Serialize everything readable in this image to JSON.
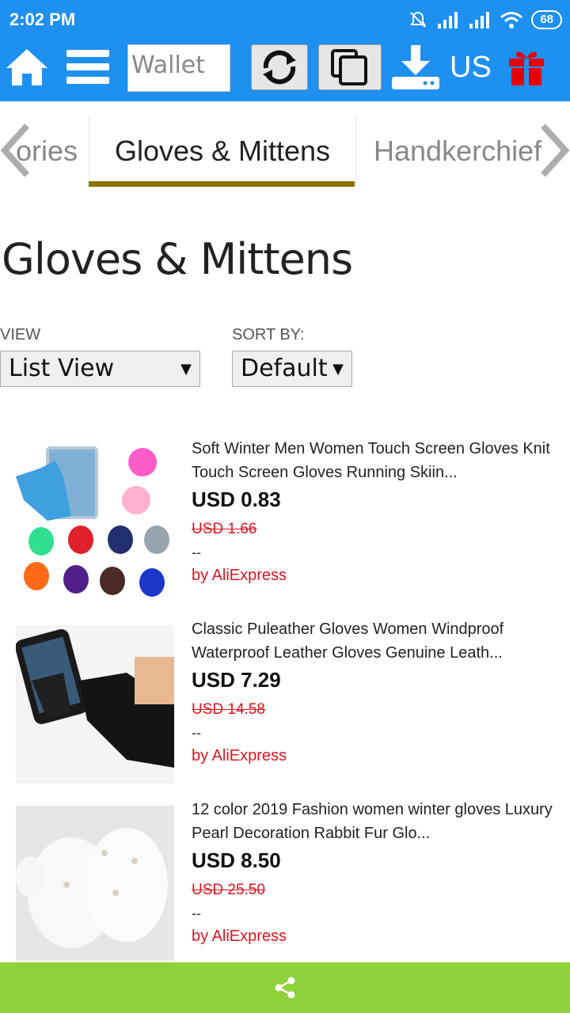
{
  "status": {
    "time": "2:02 PM",
    "battery": "68"
  },
  "toolbar": {
    "wallet_value": "Wallet",
    "region": "US"
  },
  "tabs": [
    {
      "label": "ories"
    },
    {
      "label": "Gloves & Mittens"
    },
    {
      "label": "Handkerchief"
    }
  ],
  "page": {
    "title": "Gloves & Mittens"
  },
  "controls": {
    "view_label": "VIEW",
    "view_value": "List View",
    "sort_label": "SORT BY:",
    "sort_value": "Default"
  },
  "products": [
    {
      "title": "Soft Winter Men Women Touch Screen Gloves Knit Touch Screen Gloves Running Skiin...",
      "price": "USD 0.83",
      "old_price": "USD 1.66",
      "note": "--",
      "seller": "by AliExpress"
    },
    {
      "title": "Classic Puleather Gloves Women Windproof Waterproof Leather Gloves Genuine Leath...",
      "price": "USD 7.29",
      "old_price": "USD 14.58",
      "note": "--",
      "seller": "by AliExpress"
    },
    {
      "title": "12 color 2019 Fashion women winter gloves Luxury Pearl Decoration Rabbit Fur Glo...",
      "price": "USD 8.50",
      "old_price": "USD 25.50",
      "note": "--",
      "seller": "by AliExpress"
    }
  ],
  "icons": [
    "home-icon",
    "menu-icon",
    "refresh-icon",
    "copy-icon",
    "download-icon",
    "gift-icon",
    "share-icon",
    "chevron-left-icon",
    "chevron-right-icon"
  ],
  "colors": {
    "topbar": "#1e90f0",
    "sharebar": "#8fd13a",
    "accent_red": "#e0141e",
    "tab_underline": "#8a7400"
  }
}
